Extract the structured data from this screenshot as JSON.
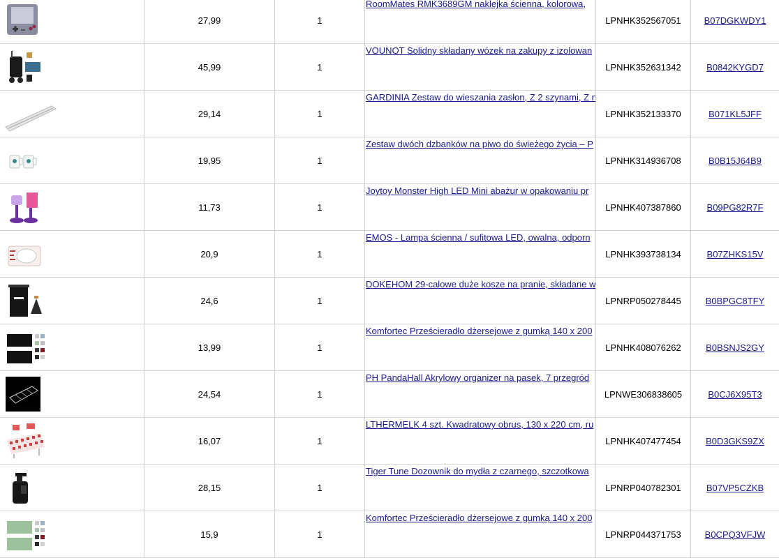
{
  "rows": [
    {
      "image": "game-console-sticker-thumbnail",
      "price": "27,99",
      "qty": "1",
      "name": "RoomMates RMK3689GM naklejka ścienna, kolorowa,",
      "lpn": "LPNHK352567051",
      "asin": "B07DGKWDY1"
    },
    {
      "image": "shopping-trolley-thumbnail",
      "price": "45,99",
      "qty": "1",
      "name": "VOUNOT Solidny składany wózek na zakupy z izolowan",
      "lpn": "LPNHK352631342",
      "asin": "B0842KYGD7"
    },
    {
      "image": "curtain-rail-thumbnail",
      "price": "29,14",
      "qty": "1",
      "name": "GARDINIA Zestaw do wieszania zasłon, Z 2 szynami, Z n",
      "lpn": "LPNHK352133370",
      "asin": "B071KL5JFF"
    },
    {
      "image": "beer-mugs-thumbnail",
      "price": "19,95",
      "qty": "1",
      "name": "Zestaw dwóch dzbanków na piwo do świeżego życia – P",
      "lpn": "LPNHK314936708",
      "asin": "B0B15J64B9"
    },
    {
      "image": "mini-lamp-thumbnail",
      "price": "11,73",
      "qty": "1",
      "name": "Joytoy Monster High LED Mini abażur w opakowaniu pr",
      "lpn": "LPNHK407387860",
      "asin": "B09PG82R7F"
    },
    {
      "image": "ceiling-lamp-thumbnail",
      "price": "20,9",
      "qty": "1",
      "name": "EMOS - Lampa ścienna / sufitowa LED, owalna, odporn",
      "lpn": "LPNHK393738134",
      "asin": "B07ZHKS15V"
    },
    {
      "image": "laundry-basket-thumbnail",
      "price": "24,6",
      "qty": "1",
      "name": "DOKEHOM 29-calowe duże kosze na pranie, składane w",
      "lpn": "LPNRP050278445",
      "asin": "B0BPGC8TFY"
    },
    {
      "image": "bedsheet-black-thumbnail",
      "price": "13,99",
      "qty": "1",
      "name": "Komfortec Prześcieradło dżersejowe z gumką 140 x 200",
      "lpn": "LPNHK408076262",
      "asin": "B0BSNJS2GY"
    },
    {
      "image": "acrylic-organizer-thumbnail",
      "price": "24,54",
      "qty": "1",
      "name": "PH PandaHall Akrylowy organizer na pasek, 7 przegród",
      "lpn": "LPNWE306838605",
      "asin": "B0CJ6X95T3"
    },
    {
      "image": "tablecloth-thumbnail",
      "price": "16,07",
      "qty": "1",
      "name": "LTHERMELK 4 szt. Kwadratowy obrus, 130 x 220 cm, ru",
      "lpn": "LPNHK407477454",
      "asin": "B0D3GKS9ZX"
    },
    {
      "image": "soap-dispenser-thumbnail",
      "price": "28,15",
      "qty": "1",
      "name": "Tiger Tune Dozownik do mydła z czarnego, szczotkowa",
      "lpn": "LPNRP040782301",
      "asin": "B07VP5CZKB"
    },
    {
      "image": "bedsheet-green-thumbnail",
      "price": "15,9",
      "qty": "1",
      "name": "Komfortec Prześcieradło dżersejowe z gumką 140 x 200",
      "lpn": "LPNRP044371753",
      "asin": "B0CPQ3VFJW"
    }
  ]
}
